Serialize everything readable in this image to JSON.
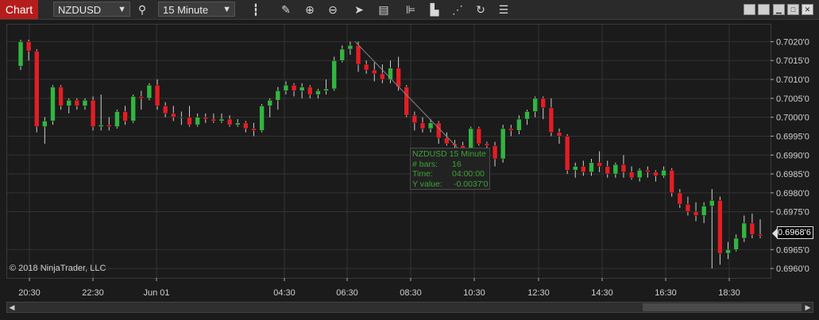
{
  "toolbar": {
    "chart_tab": "Chart",
    "instrument": "NZDUSD",
    "interval": "15 Minute",
    "icons": [
      "search-icon",
      "bar-type-icon",
      "pencil-icon",
      "zoom-in-icon",
      "zoom-out-icon",
      "pointer-icon",
      "data-box-icon",
      "strategies-icon",
      "templates-icon",
      "drawing-tools-icon",
      "reload-icon",
      "properties-icon"
    ]
  },
  "window": {
    "buttons": [
      "tile-icon",
      "detach-icon",
      "minimize-icon",
      "maximize-icon",
      "close-icon"
    ]
  },
  "copyright": "© 2018 NinjaTrader, LLC",
  "price_axis": {
    "labels": [
      "0.7020'0",
      "0.7015'0",
      "0.7010'0",
      "0.7005'0",
      "0.7000'0",
      "0.6995'0",
      "0.6990'0",
      "0.6985'0",
      "0.6980'0",
      "0.6975'0",
      "0.6965'0",
      "0.6960'0"
    ],
    "current_price": "0.6968'6"
  },
  "time_axis": {
    "labels": [
      "20:30",
      "22:30",
      "Jun 01",
      "04:30",
      "06:30",
      "08:30",
      "10:30",
      "12:30",
      "14:30",
      "16:30",
      "18:30"
    ]
  },
  "info_box": {
    "title": "NZDUSD 15 Minute",
    "bars_label": "# bars:",
    "bars_value": "16",
    "time_label": "Time:",
    "time_value": "04:00:00",
    "y_label": "Y value:",
    "y_value": "-0.0037'0"
  },
  "colors": {
    "up": "#33b441",
    "down": "#e01f25",
    "grid": "#333333",
    "text": "#d0d0d0"
  },
  "chart_data": {
    "type": "candlestick",
    "instrument": "NZDUSD",
    "interval": "15 Minute",
    "y_range": [
      0.6958,
      0.7023
    ],
    "candles": [
      [
        0.70135,
        0.70205,
        0.70125,
        0.702
      ],
      [
        0.702,
        0.70205,
        0.7015,
        0.70175
      ],
      [
        0.70175,
        0.7018,
        0.6996,
        0.69975
      ],
      [
        0.69975,
        0.7,
        0.6993,
        0.6999
      ],
      [
        0.6999,
        0.70085,
        0.6998,
        0.7008
      ],
      [
        0.7008,
        0.70085,
        0.7002,
        0.7003
      ],
      [
        0.7003,
        0.7005,
        0.7001,
        0.70045
      ],
      [
        0.70045,
        0.7005,
        0.7002,
        0.7003
      ],
      [
        0.7003,
        0.7005,
        0.7002,
        0.70045
      ],
      [
        0.70045,
        0.70055,
        0.69965,
        0.69975
      ],
      [
        0.69975,
        0.7006,
        0.69965,
        0.6998
      ],
      [
        0.6998,
        0.7,
        0.69965,
        0.69975
      ],
      [
        0.69975,
        0.7002,
        0.6997,
        0.70015
      ],
      [
        0.70015,
        0.7003,
        0.6998,
        0.6999
      ],
      [
        0.6999,
        0.7006,
        0.69985,
        0.70055
      ],
      [
        0.70055,
        0.7007,
        0.7002,
        0.7005
      ],
      [
        0.7005,
        0.7009,
        0.70045,
        0.70085
      ],
      [
        0.70085,
        0.701,
        0.7002,
        0.7003
      ],
      [
        0.7003,
        0.7004,
        0.7,
        0.7001
      ],
      [
        0.7001,
        0.7003,
        0.6999,
        0.7
      ],
      [
        0.7,
        0.70015,
        0.6998,
        0.7
      ],
      [
        0.7,
        0.7003,
        0.69975,
        0.6998
      ],
      [
        0.6998,
        0.7001,
        0.69975,
        0.7
      ],
      [
        0.7,
        0.7001,
        0.69985,
        0.69995
      ],
      [
        0.69995,
        0.7001,
        0.69985,
        0.6999
      ],
      [
        0.6999,
        0.7001,
        0.69985,
        0.69995
      ],
      [
        0.69995,
        0.70005,
        0.69975,
        0.6998
      ],
      [
        0.6998,
        0.69995,
        0.69975,
        0.69985
      ],
      [
        0.69985,
        0.6999,
        0.6996,
        0.6997
      ],
      [
        0.6997,
        0.69985,
        0.6995,
        0.69965
      ],
      [
        0.69965,
        0.70035,
        0.6996,
        0.7003
      ],
      [
        0.7003,
        0.7005,
        0.7,
        0.70045
      ],
      [
        0.70045,
        0.7008,
        0.7002,
        0.7007
      ],
      [
        0.7007,
        0.70095,
        0.7006,
        0.70085
      ],
      [
        0.70085,
        0.7009,
        0.70055,
        0.7007
      ],
      [
        0.7007,
        0.7009,
        0.7005,
        0.7008
      ],
      [
        0.7008,
        0.70085,
        0.7005,
        0.7006
      ],
      [
        0.7006,
        0.70075,
        0.7005,
        0.7007
      ],
      [
        0.7007,
        0.701,
        0.7006,
        0.70075
      ],
      [
        0.70075,
        0.7016,
        0.7007,
        0.7015
      ],
      [
        0.7015,
        0.7019,
        0.70145,
        0.7018
      ],
      [
        0.7018,
        0.702,
        0.70165,
        0.7019
      ],
      [
        0.7019,
        0.702,
        0.7012,
        0.7014
      ],
      [
        0.7014,
        0.7015,
        0.70115,
        0.70125
      ],
      [
        0.70125,
        0.70145,
        0.70095,
        0.70115
      ],
      [
        0.70115,
        0.7014,
        0.7009,
        0.701
      ],
      [
        0.701,
        0.7015,
        0.7009,
        0.7013
      ],
      [
        0.7013,
        0.7016,
        0.7007,
        0.7008
      ],
      [
        0.7008,
        0.70085,
        0.7,
        0.70005
      ],
      [
        0.70005,
        0.70015,
        0.69965,
        0.69985
      ],
      [
        0.69985,
        0.7,
        0.6996,
        0.6997
      ],
      [
        0.6997,
        0.69995,
        0.6996,
        0.69985
      ],
      [
        0.69985,
        0.6999,
        0.6993,
        0.69945
      ],
      [
        0.69945,
        0.6996,
        0.69925,
        0.6993
      ],
      [
        0.6993,
        0.6994,
        0.6991,
        0.69925
      ],
      [
        0.69925,
        0.69935,
        0.69905,
        0.6991
      ],
      [
        0.6991,
        0.69975,
        0.699,
        0.6997
      ],
      [
        0.6997,
        0.69975,
        0.69925,
        0.6993
      ],
      [
        0.6993,
        0.69935,
        0.6991,
        0.69925
      ],
      [
        0.69925,
        0.69935,
        0.6987,
        0.6989
      ],
      [
        0.6989,
        0.6998,
        0.6988,
        0.6997
      ],
      [
        0.6997,
        0.6998,
        0.6995,
        0.69965
      ],
      [
        0.69965,
        0.70005,
        0.69955,
        0.69995
      ],
      [
        0.69995,
        0.7002,
        0.6998,
        0.70015
      ],
      [
        0.70015,
        0.70055,
        0.7,
        0.7005
      ],
      [
        0.7005,
        0.70055,
        0.69995,
        0.70025
      ],
      [
        0.70025,
        0.7005,
        0.6995,
        0.6996
      ],
      [
        0.6996,
        0.6997,
        0.6993,
        0.6995
      ],
      [
        0.6995,
        0.69955,
        0.6985,
        0.6986
      ],
      [
        0.6986,
        0.6988,
        0.6984,
        0.6987
      ],
      [
        0.6987,
        0.69885,
        0.69845,
        0.69855
      ],
      [
        0.69855,
        0.6989,
        0.69845,
        0.6988
      ],
      [
        0.6988,
        0.6991,
        0.69855,
        0.6987
      ],
      [
        0.6987,
        0.69885,
        0.6984,
        0.6985
      ],
      [
        0.6985,
        0.6988,
        0.6984,
        0.69875
      ],
      [
        0.69875,
        0.699,
        0.6984,
        0.69855
      ],
      [
        0.69855,
        0.6987,
        0.69835,
        0.6984
      ],
      [
        0.6984,
        0.69865,
        0.6983,
        0.6986
      ],
      [
        0.6986,
        0.6987,
        0.6984,
        0.69855
      ],
      [
        0.69855,
        0.6986,
        0.6983,
        0.69845
      ],
      [
        0.69845,
        0.6987,
        0.6984,
        0.6986
      ],
      [
        0.6986,
        0.69865,
        0.6979,
        0.698
      ],
      [
        0.698,
        0.6981,
        0.6976,
        0.6977
      ],
      [
        0.6977,
        0.6979,
        0.6974,
        0.6975
      ],
      [
        0.6975,
        0.69775,
        0.69725,
        0.6974
      ],
      [
        0.6974,
        0.69775,
        0.6972,
        0.69765
      ],
      [
        0.69765,
        0.6981,
        0.696,
        0.6978
      ],
      [
        0.6978,
        0.6979,
        0.6961,
        0.6964
      ],
      [
        0.6964,
        0.6967,
        0.69625,
        0.6965
      ],
      [
        0.6965,
        0.6969,
        0.69645,
        0.6968
      ],
      [
        0.6968,
        0.6974,
        0.6967,
        0.6972
      ],
      [
        0.6972,
        0.69745,
        0.6968,
        0.6969
      ],
      [
        0.6969,
        0.6973,
        0.6968,
        0.69686
      ]
    ]
  }
}
